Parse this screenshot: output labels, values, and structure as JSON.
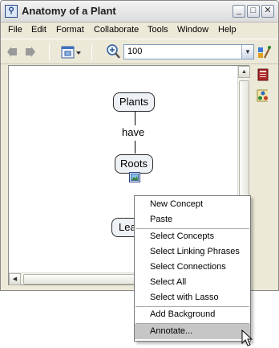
{
  "window": {
    "title": "Anatomy of a Plant"
  },
  "titlebar": {
    "minimize": "_",
    "restore": "□",
    "close": "✕"
  },
  "menubar": {
    "items": [
      "File",
      "Edit",
      "Format",
      "Collaborate",
      "Tools",
      "Window",
      "Help"
    ]
  },
  "toolbar": {
    "zoom_value": "100"
  },
  "concept_map": {
    "concepts": [
      "Plants",
      "Roots",
      "Lea"
    ],
    "linking_phrases": [
      "have"
    ]
  },
  "context_menu": {
    "items": [
      "New Concept",
      "Paste",
      "Select Concepts",
      "Select Linking Phrases",
      "Select Connections",
      "Select All",
      "Select with Lasso",
      "Add Background",
      "Annotate..."
    ],
    "highlighted": "Annotate..."
  },
  "icons": {
    "back": "arrow-left-icon",
    "forward": "arrow-right-icon",
    "view": "view-icon",
    "zoom": "zoom-icon",
    "style": "style-palette-icon",
    "views_panel": "book-icon",
    "collaboration_panel": "network-icon",
    "resource": "image-resource-icon"
  },
  "colors": {
    "concept_fill": "#eef2f6",
    "menu_highlight": "#c6c6c6"
  }
}
